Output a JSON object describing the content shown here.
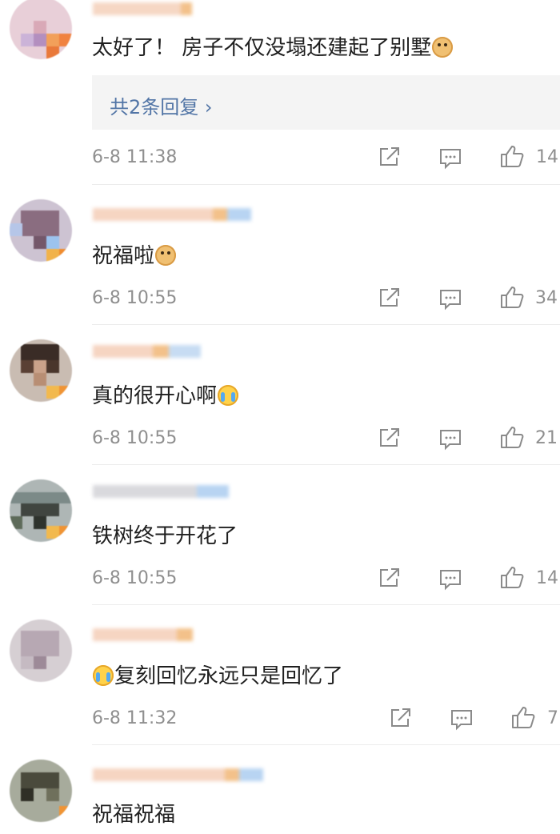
{
  "comments": [
    {
      "content": "太好了！ 房子不仅没塌还建起了别墅",
      "trailing_emoji": "doge-emoji",
      "replies_label": "共2条回复 ›",
      "time": "6-8 11:38",
      "likes": "14"
    },
    {
      "content": "祝福啦",
      "trailing_emoji": "doge-emoji",
      "time": "6-8 10:55",
      "likes": "34"
    },
    {
      "content": "真的很开心啊",
      "trailing_emoji": "crying-emoji",
      "time": "6-8 10:55",
      "likes": "21"
    },
    {
      "content": "铁树终于开花了",
      "time": "6-8 10:55",
      "likes": "14"
    },
    {
      "content": "复刻回忆永远只是回忆了",
      "leading_emoji": "crying-emoji",
      "time": "6-8 11:32",
      "likes": "7"
    },
    {
      "content": "祝福祝福"
    }
  ],
  "icons": {
    "share": "share-icon",
    "comment": "comment-icon",
    "like": "thumbs-up-icon"
  },
  "colors": {
    "reply_link": "#5275a6",
    "meta_text": "#8f8f8f",
    "reply_bg": "#f4f4f4"
  }
}
